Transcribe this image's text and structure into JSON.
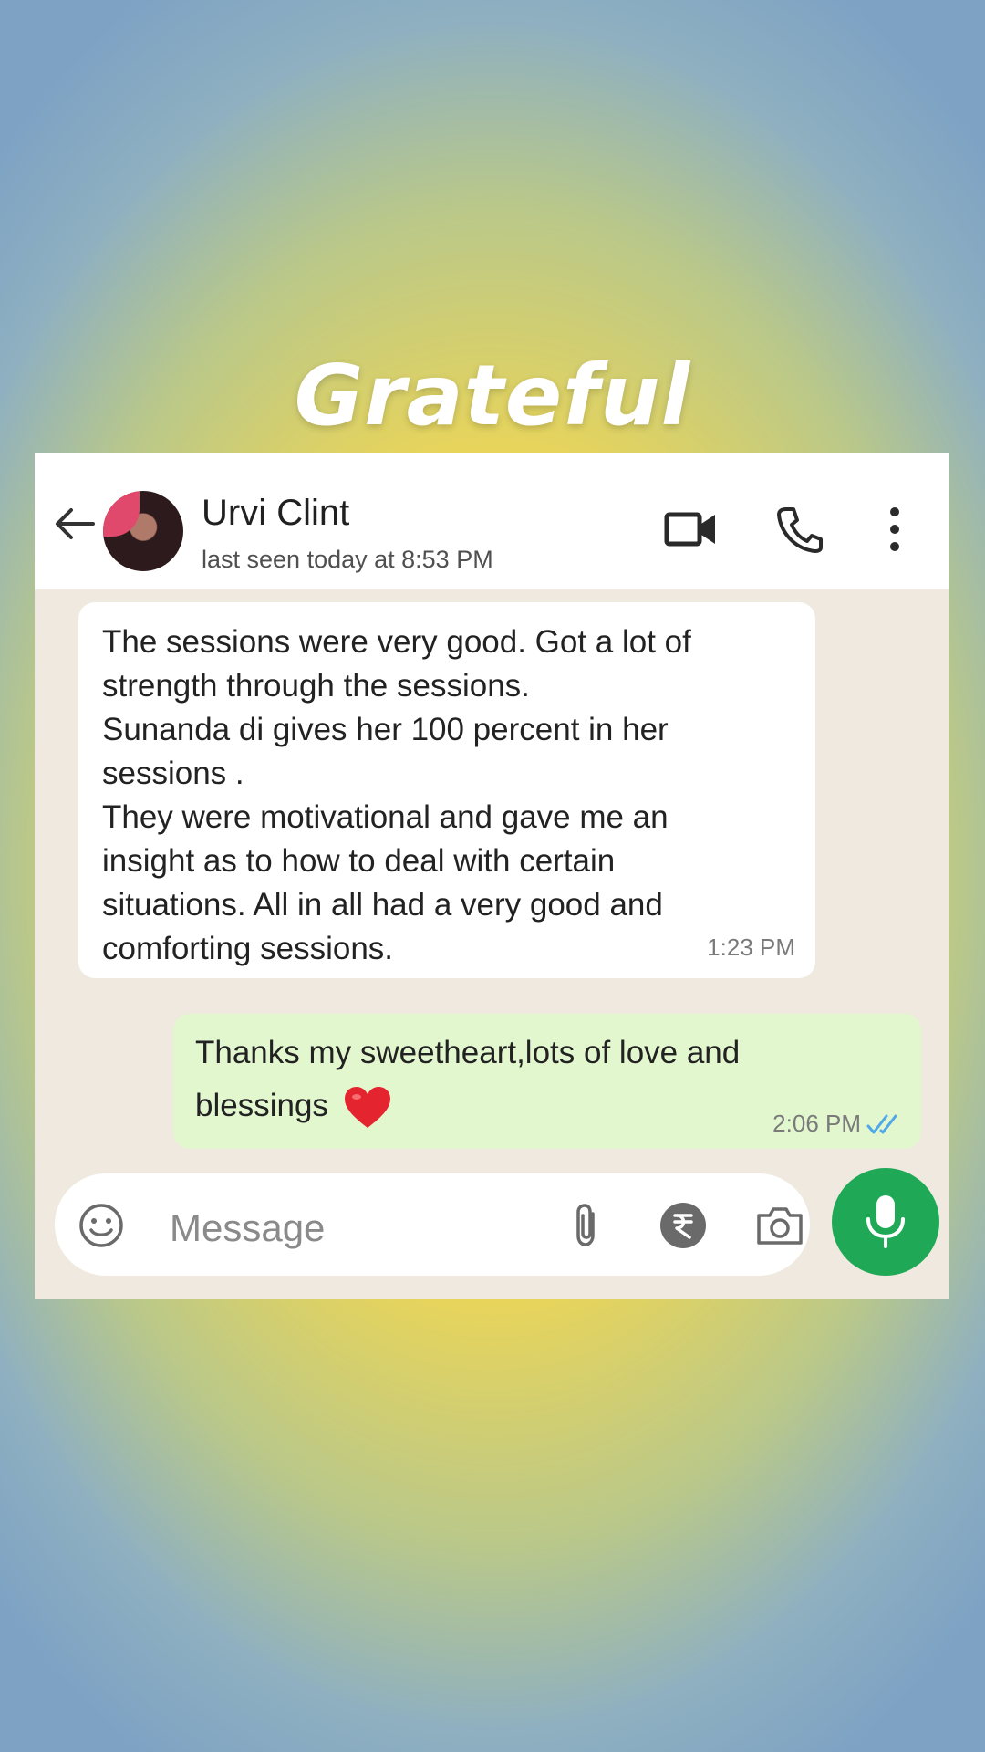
{
  "headline": "Grateful",
  "chat": {
    "contact_name": "Urvi Clint",
    "last_seen": "last seen today at 8:53 PM",
    "header_icons": [
      "back-arrow-icon",
      "video-call-icon",
      "phone-icon",
      "more-vert-icon"
    ]
  },
  "messages": [
    {
      "direction": "incoming",
      "text": "The sessions were very good. Got a lot of\nstrength through the sessions.\nSunanda di gives her 100 percent in her\nsessions .\nThey were motivational and gave me an\ninsight as to how to deal with certain\nsituations. All in all had a very good and\ncomforting sessions.",
      "time": "1:23 PM"
    },
    {
      "direction": "outgoing",
      "text_line1": "Thanks my sweetheart,lots of love and",
      "text_line2": "blessings",
      "emoji": "red-heart",
      "time": "2:06 PM",
      "status": "read"
    }
  ],
  "composer": {
    "placeholder": "Message",
    "icons": [
      "emoji-icon",
      "attach-icon",
      "rupee-icon",
      "camera-icon",
      "mic-icon"
    ]
  },
  "colors": {
    "outgoing_bubble": "#e3f7cf",
    "mic_button": "#1fa855",
    "read_ticks": "#4fa8e8",
    "heart": "#e4252f"
  }
}
